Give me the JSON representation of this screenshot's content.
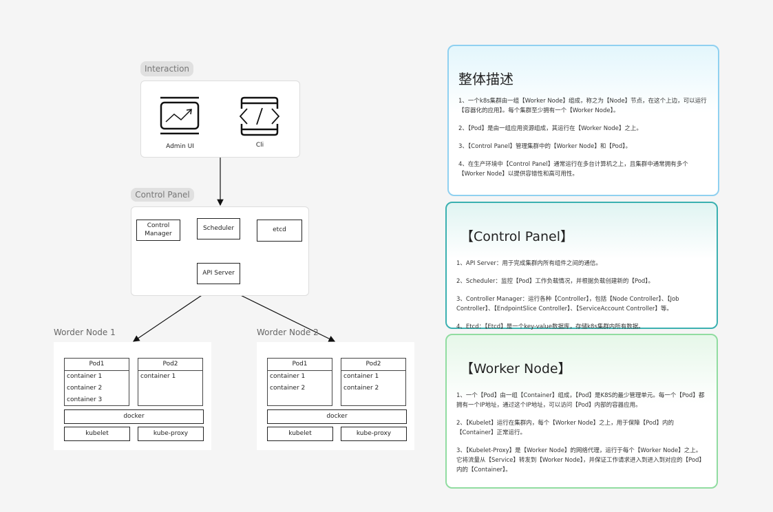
{
  "diagram": {
    "interaction": {
      "label": "Interaction",
      "items": [
        {
          "icon": "chart-monitor-icon",
          "label": "Admin UI"
        },
        {
          "icon": "code-icon",
          "label": "Cli"
        }
      ]
    },
    "control_panel": {
      "label": "Control Panel",
      "components": [
        "Control Manager",
        "Scheduler",
        "etcd"
      ],
      "api_server": "API Server"
    },
    "worker_nodes": [
      {
        "label": "Worder Node 1",
        "pods": [
          {
            "name": "Pod1",
            "containers": [
              "container 1",
              "container 2",
              "container 3"
            ]
          },
          {
            "name": "Pod2",
            "containers": [
              "container 1"
            ]
          }
        ],
        "runtime": "docker",
        "agents": [
          "kubelet",
          "kube-proxy"
        ]
      },
      {
        "label": "Worder Node 2",
        "pods": [
          {
            "name": "Pod1",
            "containers": [
              "container 1",
              "container 2"
            ]
          },
          {
            "name": "Pod2",
            "containers": [
              "container 1",
              "container 2"
            ]
          }
        ],
        "runtime": "docker",
        "agents": [
          "kubelet",
          "kube-proxy"
        ]
      }
    ]
  },
  "cards": [
    {
      "title": "整体描述",
      "color": "#8fd0f0",
      "paragraphs": [
        "1、一个k8s集群由一组【Worker Node】组成，称之为【Node】节点，在这个上边，可以运行【容器化的应用】。每个集群至少拥有一个【Worker Node】。",
        "2、【Pod】是由一组应用资源组成，其运行在【Worker Node】之上。",
        "3、【Control Panel】管理集群中的【Worker Node】和【Pod】。",
        "4、在生产环境中【Control Panel】通常运行在多台计算机之上，且集群中通常拥有多个【Worker Node】以提供容错性和高可用性。"
      ]
    },
    {
      "title": "【Control Panel】",
      "color": "#3ab0b0",
      "paragraphs": [
        "1、API Server：用于完成集群内所有组件之间的通信。",
        "2、Scheduler：监控【Pod】工作负载情况，并根据负载创建新的【Pod】。",
        "3、Controller Manager：运行各种【Controller】，包括【Node Controller】、【Job Controller】、【EndpointSlice Controller】、【ServiceAccount Controller】等。",
        "4、Etcd：【Etcd】是一个key-value数据库，存储k8s集群内所有数据。"
      ]
    },
    {
      "title": "【Worker Node】",
      "color": "#90dca0",
      "paragraphs": [
        "1、一个【Pod】由一组【Container】组成，【Pod】是K8S的最少管理单元。每一个【Pod】都拥有一个IP地址，通过这个IP地址，可以访问【Pod】内部的容器应用。",
        "2、【Kubelet】运行在集群内，每个【Worker Node】之上，用于保障【Pod】内的【Container】正常运行。",
        "3、【Kubelet-Proxy】是【Worker Node】的网络代理，运行于每个【Worker Node】之上。它将流量从【Service】转发到【Worker Node】，并保证工作请求进入到进入到对应的【Pod】内的【Container】。"
      ]
    }
  ]
}
